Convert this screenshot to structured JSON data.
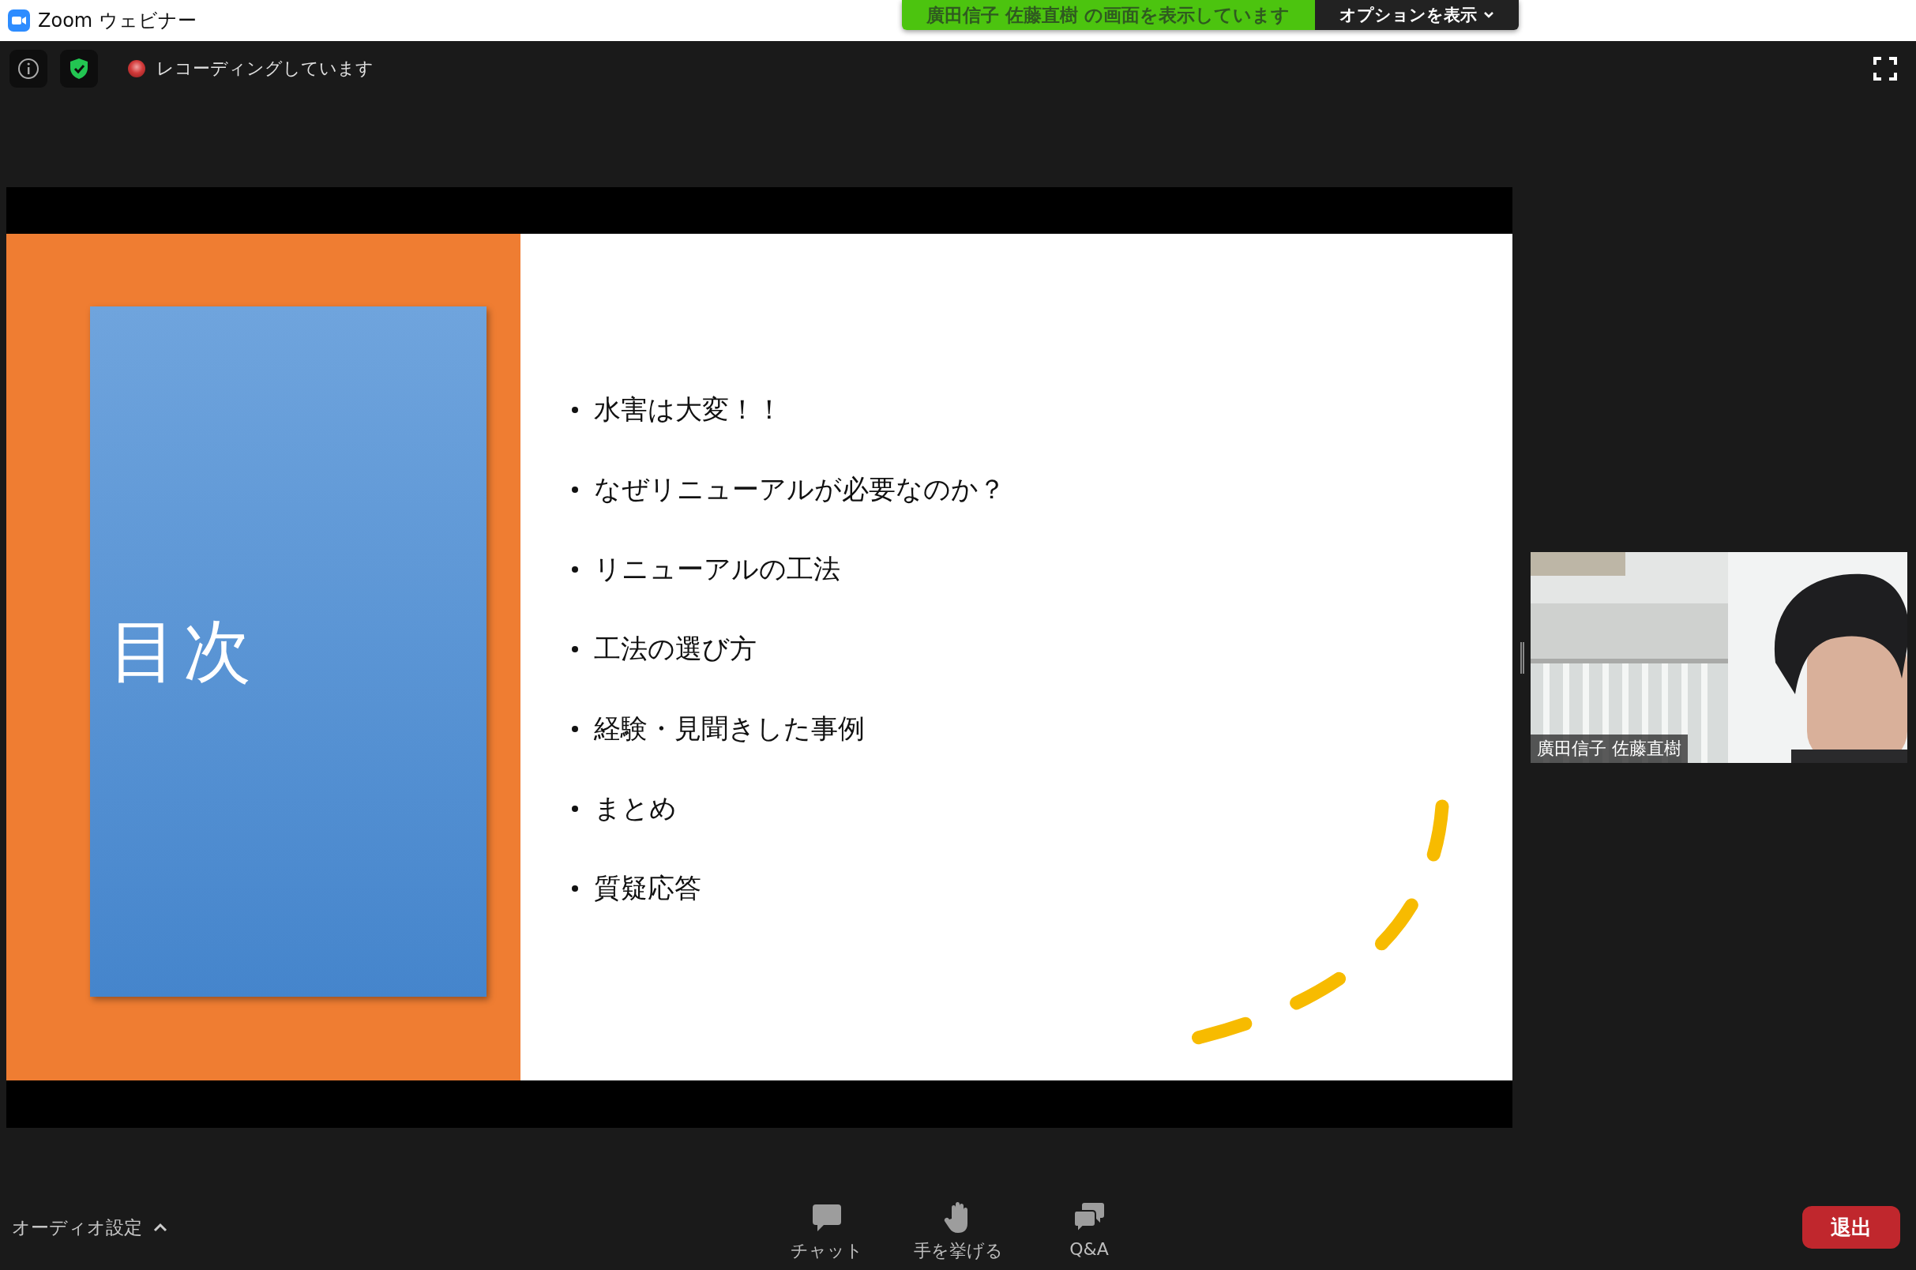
{
  "window": {
    "title": "Zoom ウェビナー"
  },
  "share_banner": {
    "text": "廣田信子 佐藤直樹 の画面を表示しています",
    "options_button": "オプションを表示"
  },
  "top_bar": {
    "recording_label": "レコーディングしています"
  },
  "slide": {
    "title": "目次",
    "items": [
      "水害は大変！！",
      "なぜリニューアルが必要なのか？",
      "リニューアルの工法",
      "工法の選び方",
      "経験・見聞きした事例",
      "まとめ",
      "質疑応答"
    ]
  },
  "video_tile": {
    "kind": "picture",
    "name": "廣田信子 佐藤直樹"
  },
  "bottom_bar": {
    "audio_settings": "オーディオ設定",
    "actions": [
      {
        "kind": "chat",
        "label": "チャット"
      },
      {
        "kind": "hand",
        "label": "手を挙げる"
      },
      {
        "kind": "qa",
        "label": "Q&A"
      }
    ],
    "leave_button": "退出"
  }
}
